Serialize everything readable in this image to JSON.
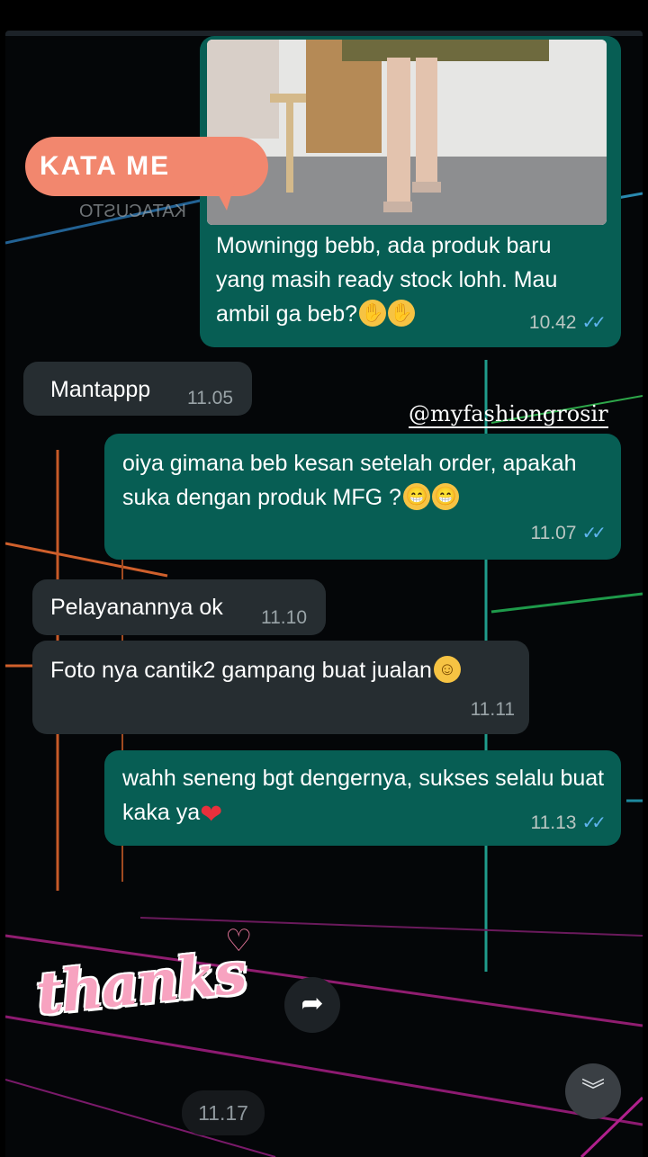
{
  "sticker_label": "KATA ME",
  "watermark_text": "KATACUSTO",
  "handle": "@myfashiongrosir",
  "messages": [
    {
      "dir": "out",
      "text": "Mowningg bebb, ada produk baru yang masih ready stock lohh. Mau ambil ga beb?",
      "emoji": "hand-over-mouth",
      "time": "10.42",
      "read": true
    },
    {
      "dir": "in",
      "text": "Mantappp",
      "time": "11.05"
    },
    {
      "dir": "out",
      "text": "oiya gimana beb kesan setelah order, apakah suka dengan produk MFG ?",
      "emoji": "grinning",
      "time": "11.07",
      "read": true
    },
    {
      "dir": "in",
      "text": "Pelayanannya ok",
      "time": "11.10"
    },
    {
      "dir": "in",
      "text": "Foto nya cantik2 gampang buat jualan",
      "emoji": "smiling",
      "time": "11.11"
    },
    {
      "dir": "out",
      "text": "wahh seneng bgt dengernya, sukses selalu buat kaka ya",
      "emoji": "red-heart",
      "time": "11.13",
      "read": true
    }
  ],
  "sticker_thanks": "thanks",
  "bottom_time": "11.17",
  "icons": {
    "forward": "forward-arrow-icon",
    "scroll": "chevron-double-down-icon",
    "read": "double-check-icon"
  },
  "colors": {
    "outgoing": "#075e54",
    "incoming": "#262d31",
    "read_tick": "#5fb5f0",
    "sticker": "#f2876e"
  }
}
